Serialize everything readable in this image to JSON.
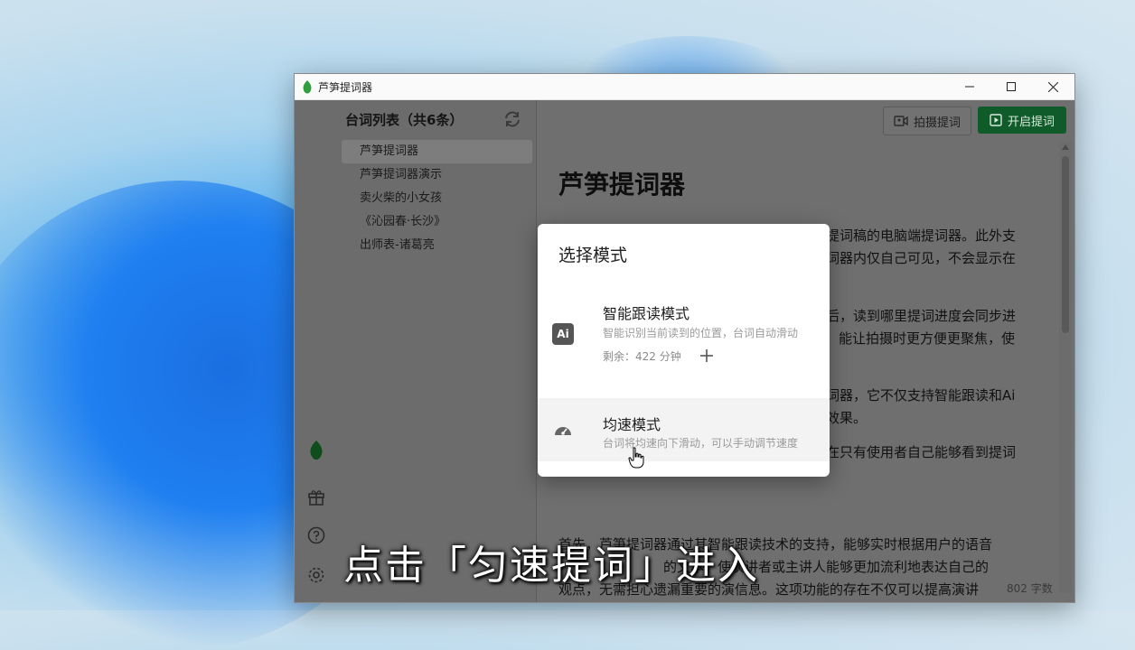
{
  "window": {
    "title": "芦笋提词器"
  },
  "sidebar": {
    "title": "台词列表（共6条）",
    "items": [
      {
        "label": "芦笋提词器",
        "active": true
      },
      {
        "label": "芦笋提词器演示"
      },
      {
        "label": "卖火柴的小女孩"
      },
      {
        "label": "《沁园春·长沙》"
      },
      {
        "label": "出师表-诸葛亮"
      }
    ],
    "icons": [
      "leaf-icon",
      "gift-icon",
      "help-icon",
      "settings-icon"
    ]
  },
  "toolbar": {
    "photo_label": "拍摄提词",
    "start_label": "开启提词",
    "start_color": "#0f5c2a"
  },
  "document": {
    "title": "芦笋提词器",
    "lines": [
      "提词稿的电脑端提词器。此外支",
      "词器内仅自己可见，不会显示在",
      "后，读到哪里提词进度会同步进",
      "能让拍摄时更方便更聚焦，使",
      "词器，它不仅支持智能跟读和Ai",
      "效果。",
      "在只有使用者自己能够看到提词",
      "首先，芦笋提词器通过其智能跟读技术的支持，能够实时根据用户的语音",
      "的文本，使演讲者或主讲人能够更加流利地表达自己的",
      "观点，无需担心遗漏重要的演信息。这项功能的存在不仅可以提高演讲"
    ],
    "word_count": "802 字数"
  },
  "dialog": {
    "title": "选择模式",
    "modes": [
      {
        "icon": "Ai",
        "name": "智能跟读模式",
        "desc": "智能识别当前读到的位置，台词自动滑动",
        "remaining": "剩余：422 分钟"
      },
      {
        "icon": "speedometer-icon",
        "name": "均速模式",
        "desc": "台词将均速向下滑动，可以手动调节速度"
      }
    ]
  },
  "caption": "点击「匀速提词」进入"
}
